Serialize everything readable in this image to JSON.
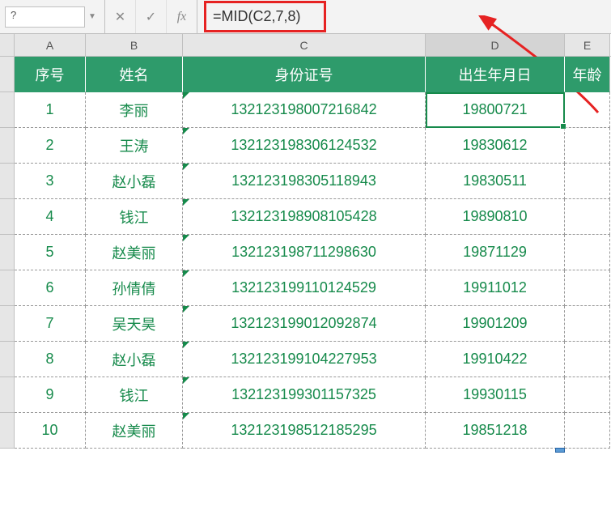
{
  "nameBox": "?",
  "formula": "=MID(C2,7,8)",
  "cols": [
    "A",
    "B",
    "C",
    "D",
    "E"
  ],
  "headers": {
    "a": "序号",
    "b": "姓名",
    "c": "身份证号",
    "d": "出生年月日",
    "e": "年龄"
  },
  "rows": [
    {
      "a": "1",
      "b": "李丽",
      "c": "132123198007216842",
      "d": "19800721"
    },
    {
      "a": "2",
      "b": "王涛",
      "c": "132123198306124532",
      "d": "19830612"
    },
    {
      "a": "3",
      "b": "赵小磊",
      "c": "132123198305118943",
      "d": "19830511"
    },
    {
      "a": "4",
      "b": "钱江",
      "c": "132123198908105428",
      "d": "19890810"
    },
    {
      "a": "5",
      "b": "赵美丽",
      "c": "132123198711298630",
      "d": "19871129"
    },
    {
      "a": "6",
      "b": "孙倩倩",
      "c": "132123199110124529",
      "d": "19911012"
    },
    {
      "a": "7",
      "b": "吴天昊",
      "c": "132123199012092874",
      "d": "19901209"
    },
    {
      "a": "8",
      "b": "赵小磊",
      "c": "132123199104227953",
      "d": "19910422"
    },
    {
      "a": "9",
      "b": "钱江",
      "c": "132123199301157325",
      "d": "19930115"
    },
    {
      "a": "10",
      "b": "赵美丽",
      "c": "132123198512185295",
      "d": "19851218"
    }
  ]
}
